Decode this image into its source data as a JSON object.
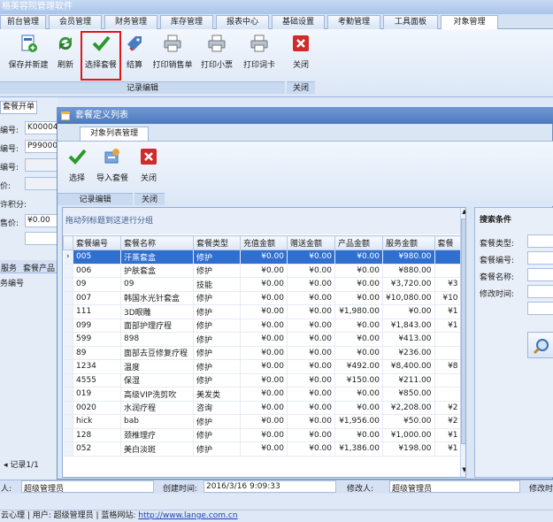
{
  "app": {
    "title": "格美容院管理软件"
  },
  "menu_tabs": [
    {
      "label": "前台管理"
    },
    {
      "label": "会员管理"
    },
    {
      "label": "财务管理"
    },
    {
      "label": "库存管理"
    },
    {
      "label": "报表中心"
    },
    {
      "label": "基础设置"
    },
    {
      "label": "考勤管理"
    },
    {
      "label": "工具面板"
    },
    {
      "label": "对象管理"
    }
  ],
  "ribbon": {
    "buttons": [
      {
        "label": "保存并新建"
      },
      {
        "label": "刷新"
      },
      {
        "label": "选择套餐"
      },
      {
        "label": "结算"
      },
      {
        "label": "打印销售单"
      },
      {
        "label": "打印小票"
      },
      {
        "label": "打印词卡"
      },
      {
        "label": "关闭"
      }
    ],
    "group_record": "记录编辑",
    "group_close": "关闭"
  },
  "left_panel": {
    "tab": "套餐开单",
    "labels": [
      "编号:",
      "编号:",
      "编号:",
      "价:",
      "许积分:",
      "售价:"
    ],
    "values": [
      "K00004",
      "P99000",
      "",
      "",
      "",
      "¥0.00"
    ],
    "sub_tabs": [
      "服务",
      "套餐产品"
    ],
    "sub_header": "务编号",
    "pager": "记录1/1"
  },
  "dialog": {
    "title": "套餐定义列表",
    "tab": "对象列表管理",
    "buttons": [
      {
        "label": "选择"
      },
      {
        "label": "导入套餐"
      },
      {
        "label": "关闭"
      }
    ],
    "group_record": "记录编辑",
    "group_close": "关闭",
    "group_hint": "拖动列标题到这进行分组",
    "columns": [
      "套餐编号",
      "套餐名称",
      "套餐类型",
      "充值金额",
      "赠送金额",
      "产品金额",
      "服务金额",
      "套餐"
    ],
    "rows": [
      [
        "005",
        "汗蒸套盒",
        "修护",
        "¥0.00",
        "¥0.00",
        "¥0.00",
        "¥980.00",
        ""
      ],
      [
        "006",
        "护肤套盒",
        "修护",
        "¥0.00",
        "¥0.00",
        "¥0.00",
        "¥880.00",
        ""
      ],
      [
        "09",
        "09",
        "技能",
        "¥0.00",
        "¥0.00",
        "¥0.00",
        "¥3,720.00",
        "¥3"
      ],
      [
        "007",
        "韩国水光针套盒",
        "修护",
        "¥0.00",
        "¥0.00",
        "¥0.00",
        "¥10,080.00",
        "¥10"
      ],
      [
        "111",
        "3D眼雕",
        "修护",
        "¥0.00",
        "¥0.00",
        "¥1,980.00",
        "¥0.00",
        "¥1"
      ],
      [
        "099",
        "面部护理疗程",
        "修护",
        "¥0.00",
        "¥0.00",
        "¥0.00",
        "¥1,843.00",
        "¥1"
      ],
      [
        "599",
        "898",
        "修护",
        "¥0.00",
        "¥0.00",
        "¥0.00",
        "¥413.00",
        ""
      ],
      [
        "89",
        "面部去豆修复疗程",
        "修护",
        "¥0.00",
        "¥0.00",
        "¥0.00",
        "¥236.00",
        ""
      ],
      [
        "1234",
        "温度",
        "修护",
        "¥0.00",
        "¥0.00",
        "¥492.00",
        "¥8,400.00",
        "¥8"
      ],
      [
        "4555",
        "保湿",
        "修护",
        "¥0.00",
        "¥0.00",
        "¥150.00",
        "¥211.00",
        ""
      ],
      [
        "019",
        "高级VIP洗剪吹",
        "美发类",
        "¥0.00",
        "¥0.00",
        "¥0.00",
        "¥850.00",
        ""
      ],
      [
        "0020",
        "水润疗程",
        "咨询",
        "¥0.00",
        "¥0.00",
        "¥0.00",
        "¥2,208.00",
        "¥2"
      ],
      [
        "hick",
        "bab",
        "修护",
        "¥0.00",
        "¥0.00",
        "¥1,956.00",
        "¥50.00",
        "¥2"
      ],
      [
        "128",
        "颈椎理疗",
        "修护",
        "¥0.00",
        "¥0.00",
        "¥0.00",
        "¥1,000.00",
        "¥1"
      ],
      [
        "052",
        "美白淡斑",
        "修护",
        "¥0.00",
        "¥0.00",
        "¥1,386.00",
        "¥198.00",
        "¥1"
      ]
    ]
  },
  "search": {
    "title": "搜索条件",
    "fields": [
      "套餐类型:",
      "套餐编号:",
      "套餐名称:",
      "修改时间:"
    ]
  },
  "status": {
    "creator_label": "人:",
    "creator": "超级管理员",
    "created_label": "创建时间:",
    "created": "2016/3/16 9:09:33",
    "modifier_label": "修改人:",
    "modifier": "超级管理员",
    "modified_label": "修改时"
  },
  "footer": {
    "text": "云心理 | 用户: 超级管理员 | 蓝格网站: ",
    "link": "http://www.lange.com.cn"
  },
  "colors": {
    "selection": "#2f6fcf",
    "highlight": "#e01818",
    "title_bar": "#4d79bd"
  }
}
